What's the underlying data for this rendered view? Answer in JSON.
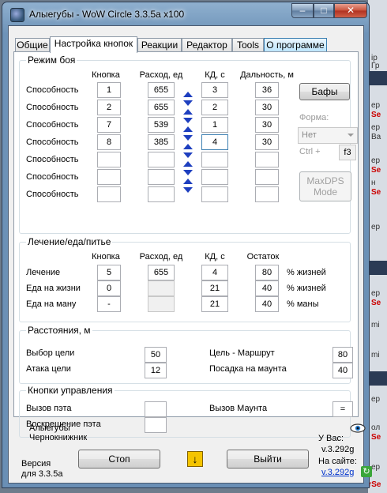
{
  "window": {
    "title": "Алыегубы - WoW Circle 3.3.5a x100"
  },
  "tabs": [
    "Общие",
    "Настройка кнопок",
    "Реакции",
    "Редактор",
    "Tools",
    "О программе"
  ],
  "combat": {
    "title": "Режим боя",
    "headers": {
      "key": "Кнопка",
      "cost": "Расход, ед",
      "cd": "КД, с",
      "range": "Дальность, м"
    },
    "row_label": "Способность",
    "rows": [
      {
        "key": "1",
        "cost": "655",
        "cd": "3",
        "range": "36"
      },
      {
        "key": "2",
        "cost": "655",
        "cd": "2",
        "range": "30"
      },
      {
        "key": "7",
        "cost": "539",
        "cd": "1",
        "range": "30"
      },
      {
        "key": "8",
        "cost": "385",
        "cd": "4",
        "range": "30"
      },
      {
        "key": "",
        "cost": "",
        "cd": "",
        "range": ""
      },
      {
        "key": "",
        "cost": "",
        "cd": "",
        "range": ""
      },
      {
        "key": "",
        "cost": "",
        "cd": "",
        "range": ""
      }
    ],
    "buffs_button": "Бафы",
    "form_label": "Форма:",
    "form_value": "Нет",
    "ctrl_label": "Ctrl +",
    "ctrl_value": "f3",
    "maxdps_button": "MaxDPS Mode"
  },
  "healing": {
    "title": "Лечение/еда/питье",
    "headers": {
      "key": "Кнопка",
      "cost": "Расход, ед",
      "cd": "КД, с",
      "rest": "Остаток"
    },
    "rows": [
      {
        "label": "Лечение",
        "key": "5",
        "cost": "655",
        "cd": "4",
        "rest": "80",
        "unit": "% жизней"
      },
      {
        "label": "Еда на жизни",
        "key": "0",
        "cost": "",
        "cd": "21",
        "rest": "40",
        "unit": "% жизней"
      },
      {
        "label": "Еда на ману",
        "key": "-",
        "cost": "",
        "cd": "21",
        "rest": "40",
        "unit": "% маны"
      }
    ]
  },
  "distances": {
    "title": "Расстояния, м",
    "select_target": "Выбор цели",
    "select_target_value": "50",
    "attack_target": "Атака цели",
    "attack_target_value": "12",
    "route_target": "Цель - Маршрут",
    "route_target_value": "80",
    "mount_landing": "Посадка на маунта",
    "mount_landing_value": "40"
  },
  "controls": {
    "title": "Кнопки управления",
    "summon_pet": "Вызов пэта",
    "summon_pet_value": "",
    "revive_pet": "Воскрешение пэта",
    "revive_pet_value": "",
    "summon_mount": "Вызов Маунта",
    "summon_mount_value": "="
  },
  "footer": {
    "char_name": "Алыегубы",
    "char_class": "Чернокнижник",
    "version_label": "Версия",
    "version_for": "для 3.3.5a",
    "stop_button": "Стоп",
    "exit_button": "Выйти",
    "you_have": "У Вас:",
    "local_version": "v.3.292g",
    "on_site": "На сайте:",
    "site_version": "v.3.292g"
  },
  "background": {
    "fragments": [
      "ip",
      "Гр",
      "ep",
      "Se",
      "ep",
      "Ba",
      "ep",
      "Se",
      "н",
      "Se",
      "ep",
      "ep",
      "Se",
      "mi",
      "mi",
      "ep",
      "ол",
      "Se",
      "ep",
      "MrSe"
    ]
  },
  "colors": {
    "accent_blue": "#1e3fbf",
    "title_glass": "#7394b8",
    "link": "#0033cc"
  }
}
